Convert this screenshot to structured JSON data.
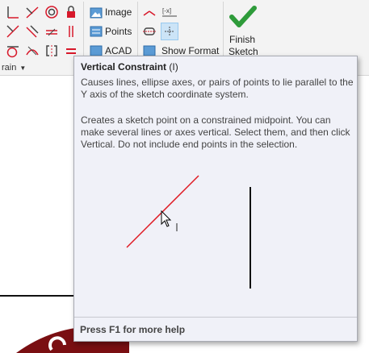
{
  "ribbon": {
    "image_label": "Image",
    "points_label": "Points",
    "acad_label": "ACAD",
    "show_format_label": "Show Format",
    "finish_sketch_label_1": "Finish",
    "finish_sketch_label_2": "Sketch",
    "constrain_label": "rain"
  },
  "tooltip": {
    "title": "Vertical Constraint",
    "shortcut": "(I)",
    "paragraph_1": "Causes lines, ellipse axes, or pairs of points to lie parallel to the Y axis of the sketch coordinate system.",
    "paragraph_2": "Creates a sketch point on a constrained midpoint. You can make several lines or axes vertical. Select them, and then click Vertical. Do not include end points in the selection.",
    "footer": "Press F1 for more help"
  },
  "colors": {
    "accent_red": "#d7182a",
    "finish_green": "#2e9b3a",
    "tooltip_bg": "#f0f1f8",
    "logo_red": "#7a0f12"
  }
}
